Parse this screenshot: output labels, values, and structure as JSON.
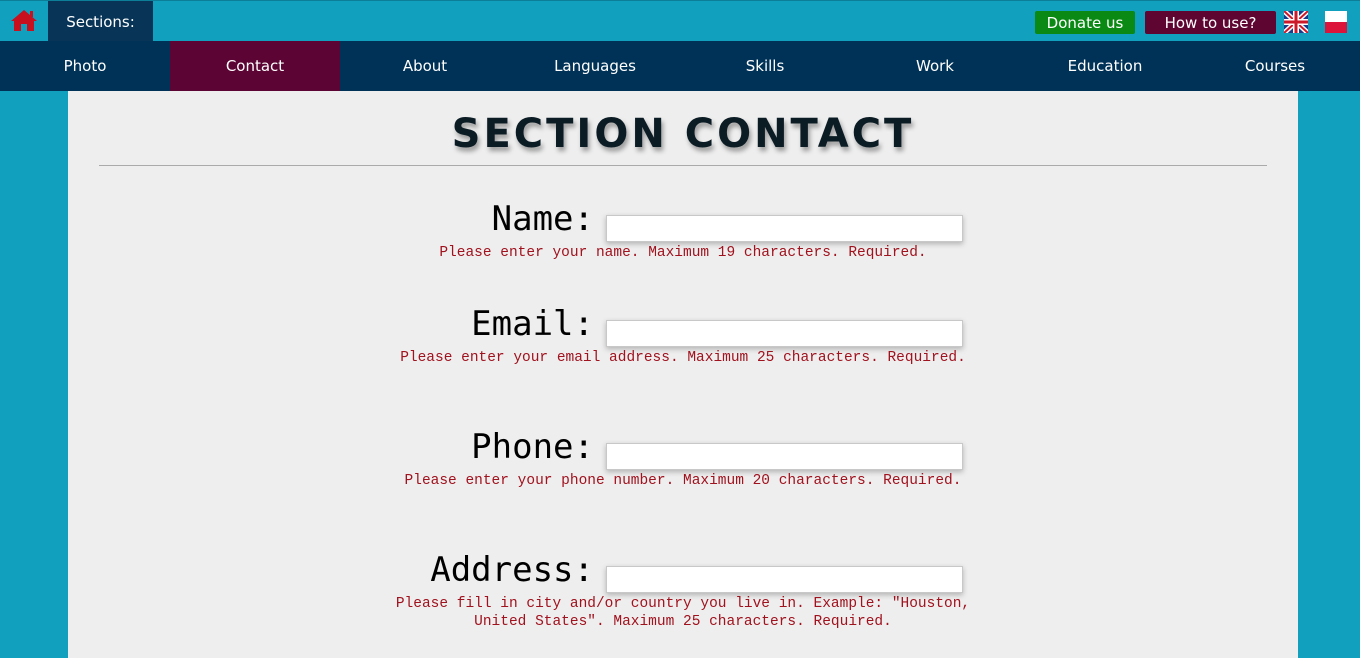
{
  "topbar": {
    "home_icon": "home-icon",
    "sections_label": "Sections:",
    "donate_label": "Donate us",
    "howto_label": "How to use?",
    "lang_en_icon": "uk-flag-icon",
    "lang_pl_icon": "poland-flag-icon"
  },
  "nav": {
    "items": [
      {
        "label": "Photo"
      },
      {
        "label": "Contact",
        "active": true
      },
      {
        "label": "About"
      },
      {
        "label": "Languages"
      },
      {
        "label": "Skills"
      },
      {
        "label": "Work"
      },
      {
        "label": "Education"
      },
      {
        "label": "Courses"
      }
    ]
  },
  "main": {
    "title": "SECTION CONTACT",
    "fields": [
      {
        "label": "Name:",
        "value": "",
        "hint": "Please enter your name. Maximum 19 characters. Required."
      },
      {
        "label": "Email:",
        "value": "",
        "hint": "Please enter your email address. Maximum 25 characters. Required."
      },
      {
        "label": "Phone:",
        "value": "",
        "hint": "Please enter your phone number. Maximum 20 characters. Required."
      },
      {
        "label": "Address:",
        "value": "",
        "hint": "Please fill in city and/or country you live in. Example: \"Houston, United States\". Maximum 25 characters. Required."
      }
    ]
  },
  "colors": {
    "background": "#12a0bf",
    "nav_bg": "#003257",
    "nav_active": "#5c0433",
    "donate": "#0a8a14",
    "howto": "#5e0531",
    "hint_text": "#a0121e"
  }
}
